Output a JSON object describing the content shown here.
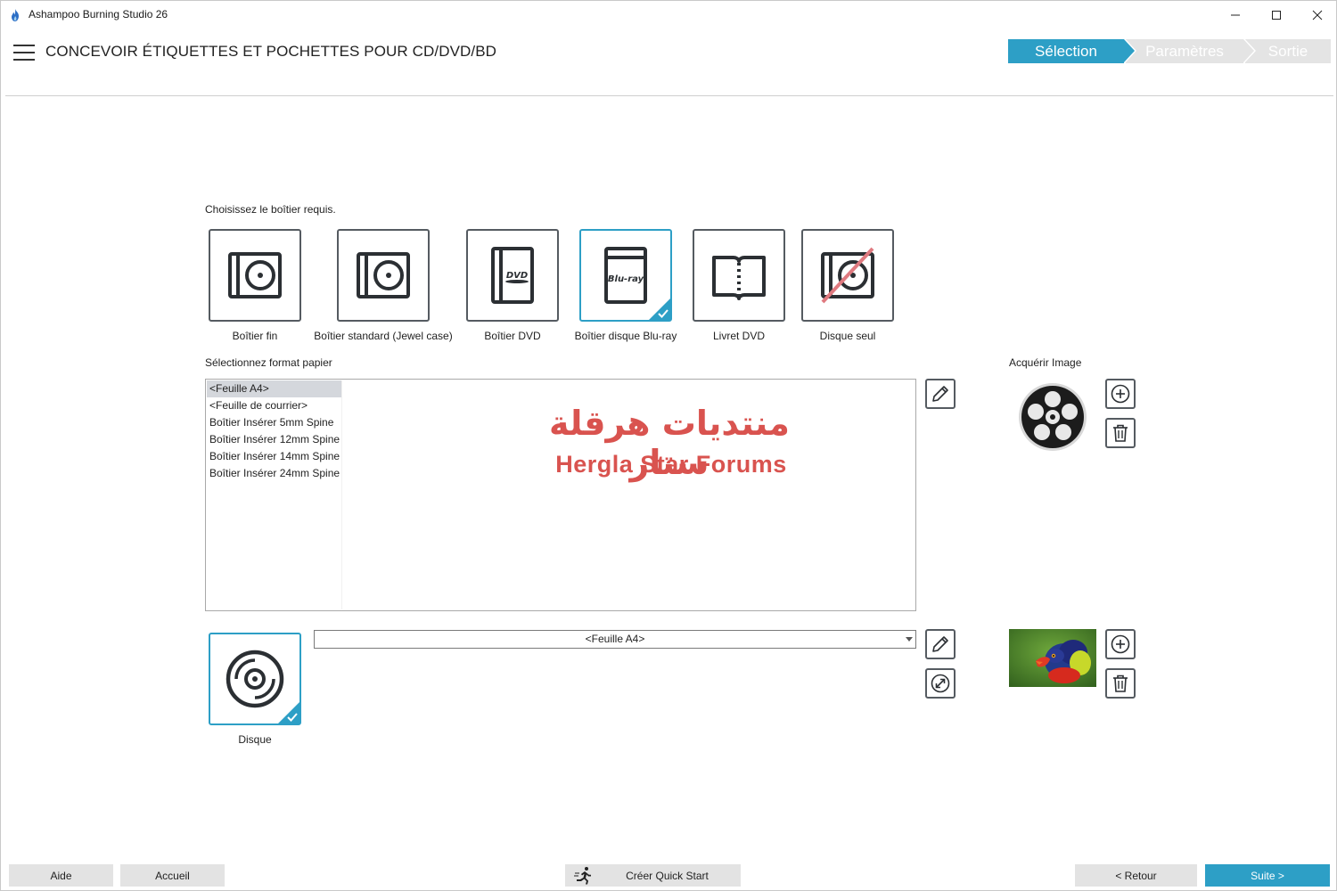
{
  "window": {
    "title": "Ashampoo Burning Studio 26",
    "accent_color": "#2d9fc6"
  },
  "header": {
    "title": "CONCEVOIR ÉTIQUETTES ET POCHETTES POUR CD/DVD/BD",
    "steps": [
      {
        "label": "Sélection",
        "active": true
      },
      {
        "label": "Paramètres",
        "active": false
      },
      {
        "label": "Sortie",
        "active": false
      }
    ]
  },
  "case_section": {
    "prompt": "Choisissez le boîtier requis.",
    "cases": [
      {
        "label": "Boîtier fin",
        "icon": "slim-case-icon",
        "selected": false
      },
      {
        "label": "Boîtier standard (Jewel case)",
        "icon": "jewel-case-icon",
        "selected": false
      },
      {
        "label": "Boîtier DVD",
        "icon": "dvd-case-icon",
        "selected": false,
        "badge": "DVD"
      },
      {
        "label": "Boîtier disque Blu-ray",
        "icon": "bluray-case-icon",
        "selected": true,
        "badge": "Blu-ray"
      },
      {
        "label": "Livret DVD",
        "icon": "booklet-icon",
        "selected": false
      },
      {
        "label": "Disque seul",
        "icon": "disc-only-icon",
        "selected": false
      }
    ]
  },
  "paper_section": {
    "prompt": "Sélectionnez format papier",
    "items": [
      {
        "label": "<Feuille A4>",
        "selected": true
      },
      {
        "label": "<Feuille de courrier>",
        "selected": false
      },
      {
        "label": "Boîtier Insérer 5mm Spine",
        "selected": false
      },
      {
        "label": "Boîtier Insérer 12mm Spine",
        "selected": false
      },
      {
        "label": "Boîtier Insérer 14mm Spine",
        "selected": false
      },
      {
        "label": "Boîtier Insérer 24mm Spine",
        "selected": false
      }
    ],
    "watermark_ar": "منتديات هرقلة ستار",
    "watermark_en": "Hergla Star Forums"
  },
  "image_section": {
    "label": "Acquérir Image"
  },
  "disc_section": {
    "label": "Disque",
    "selected": true,
    "format_value": "<Feuille A4>"
  },
  "footer": {
    "help": "Aide",
    "home": "Accueil",
    "quick_start": "Créer Quick Start",
    "back": "< Retour",
    "next": "Suite >"
  }
}
